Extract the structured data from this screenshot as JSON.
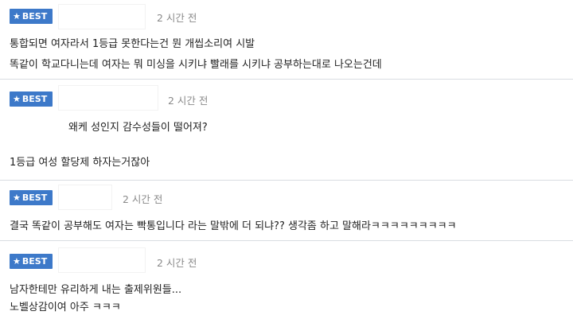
{
  "comments": [
    {
      "badge": "BEST",
      "time": "2 시간 전",
      "lines": [
        "통합되면 여자라서 1등급 못한다는건 뭔 개씹소리여 시발",
        "똑같이 학교다니는데 여자는 뭐 미싱을 시키냐 빨래를 시키냐 공부하는대로 나오는건데"
      ]
    },
    {
      "badge": "BEST",
      "time": "2 시간 전",
      "lines": [
        "왜케 성인지 감수성들이 떨어져?",
        "1등급 여성 할당제 하자는거잖아"
      ]
    },
    {
      "badge": "BEST",
      "time": "2 시간 전",
      "lines": [
        "결국 똑같이 공부해도 여자는 빡통입니다 라는 말밖에 더 되냐?? 생각좀 하고 말해라ㅋㅋㅋㅋㅋㅋㅋㅋㅋ"
      ]
    },
    {
      "badge": "BEST",
      "time": "2 시간 전",
      "lines": [
        "남자한테만 유리하게 내는 출제위원들...",
        "노벨상감이여 아주 ㅋㅋㅋ"
      ]
    }
  ]
}
